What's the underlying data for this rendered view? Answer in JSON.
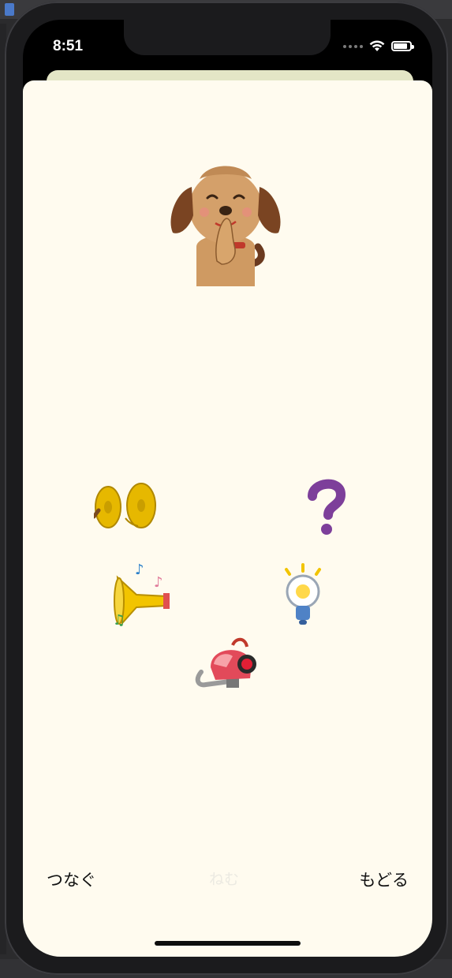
{
  "status_bar": {
    "time": "8:51"
  },
  "icons": {
    "wifi": "wifi-icon",
    "battery": "battery-icon",
    "signal": "signal-icon"
  },
  "battery_level": 0.85,
  "toolbar": {
    "left_label": "つなぐ",
    "center_label": "ねむ",
    "right_label": "もどる"
  },
  "colors": {
    "sheet_background": "#fffbef",
    "back_sheet": "#e4e6c6"
  }
}
